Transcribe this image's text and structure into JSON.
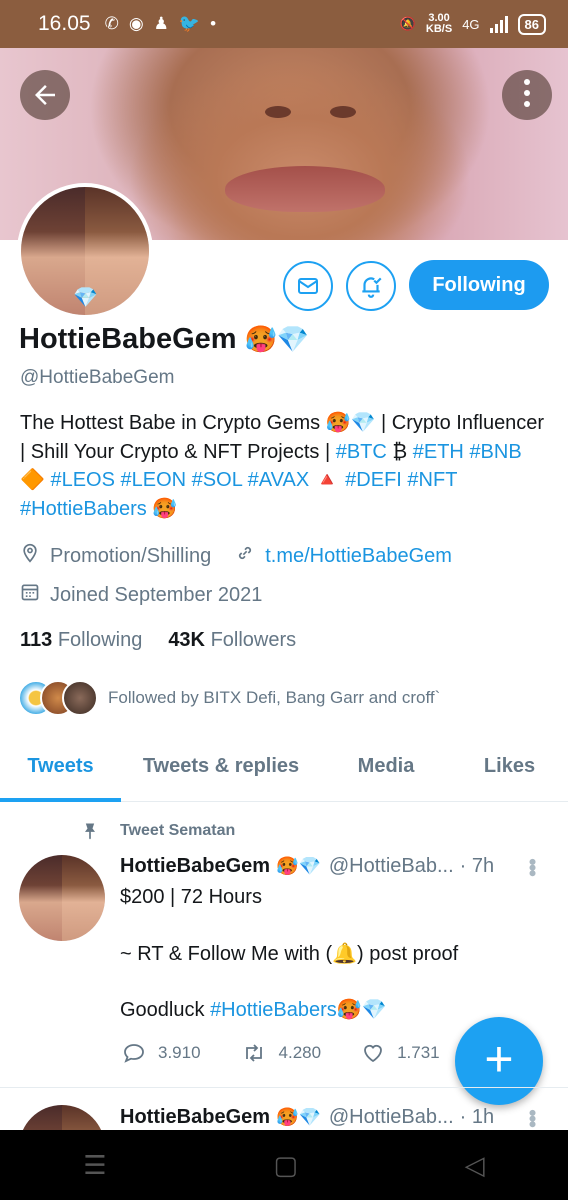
{
  "status_bar": {
    "time": "16.05",
    "speed": "3.00",
    "speed_unit": "KB/S",
    "network": "4G",
    "battery": "86"
  },
  "profile": {
    "name": "HottieBabeGem",
    "name_emojis": "🥵💎",
    "handle": "@HottieBabeGem",
    "follow_label": "Following",
    "bio_parts": [
      {
        "t": "The Hottest Babe in Crypto Gems 🥵💎 | Crypto Influencer | Shill Your Crypto & NFT Projects | ",
        "tag": false
      },
      {
        "t": "#BTC",
        "tag": true
      },
      {
        "t": " ₿ ",
        "tag": false
      },
      {
        "t": "#ETH",
        "tag": true
      },
      {
        "t": " ",
        "tag": false
      },
      {
        "t": "#BNB",
        "tag": true
      },
      {
        "t": " 🔶  ",
        "tag": false
      },
      {
        "t": "#LEOS",
        "tag": true
      },
      {
        "t": " ",
        "tag": false
      },
      {
        "t": "#LEON",
        "tag": true
      },
      {
        "t": " ",
        "tag": false
      },
      {
        "t": "#SOL",
        "tag": true
      },
      {
        "t": " ",
        "tag": false
      },
      {
        "t": "#AVAX",
        "tag": true
      },
      {
        "t": " 🔺 ",
        "tag": false
      },
      {
        "t": "#DEFI",
        "tag": true
      },
      {
        "t": " ",
        "tag": false
      },
      {
        "t": "#NFT",
        "tag": true
      },
      {
        "t": " ",
        "tag": false
      },
      {
        "t": "#HottieBabers",
        "tag": true
      },
      {
        "t": " 🥵",
        "tag": false
      }
    ],
    "location": "Promotion/Shilling",
    "website": "t.me/HottieBabeGem",
    "joined": "Joined September 2021",
    "following_count": "113",
    "following_label": "Following",
    "followers_count": "43K",
    "followers_label": "Followers",
    "followed_by": "Followed by BITX Defi, Bang Garr and croff`"
  },
  "tabs": [
    "Tweets",
    "Tweets & replies",
    "Media",
    "Likes"
  ],
  "pinned_label": "Tweet Sematan",
  "tweets": [
    {
      "name": "HottieBabeGem",
      "emojis": "🥵💎",
      "handle": "@HottieBab...",
      "time": "· 7h",
      "line1": "$200 | 72 Hours",
      "line2": "~ RT & Follow Me with (🔔) post proof",
      "line3_text": "Goodluck ",
      "line3_tag": "#HottieBabers",
      "line3_tail": "🥵💎",
      "replies": "3.910",
      "retweets": "4.280",
      "likes": "1.731"
    },
    {
      "name": "HottieBabeGem",
      "emojis": "🥵💎",
      "handle": "@HottieBab...",
      "time": "· 1h"
    }
  ],
  "fab_label": "+",
  "colors": {
    "accent": "#1da1f2",
    "statusbar": "#8b5d3f"
  }
}
